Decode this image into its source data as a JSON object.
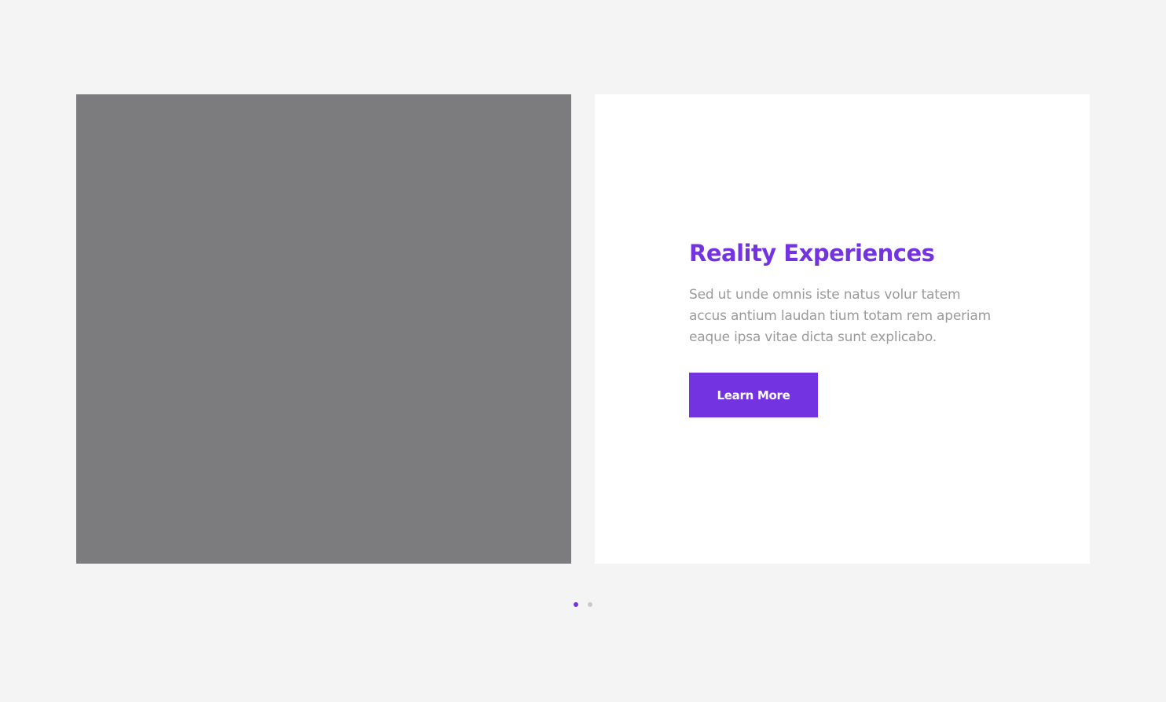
{
  "slide": {
    "title": "Reality Experiences",
    "description": "Sed ut unde omnis iste natus volur tatem accus antium laudan tium totam rem aperiam eaque ipsa vitae dicta sunt explicabo.",
    "button_label": "Learn More"
  },
  "pagination": {
    "total": 2,
    "active_index": 0
  },
  "colors": {
    "accent": "#7433e0",
    "image_placeholder": "#7c7c7e",
    "background": "#f4f4f4",
    "inactive_dot": "#c9c9c9",
    "body_text": "#9a9a9a"
  }
}
